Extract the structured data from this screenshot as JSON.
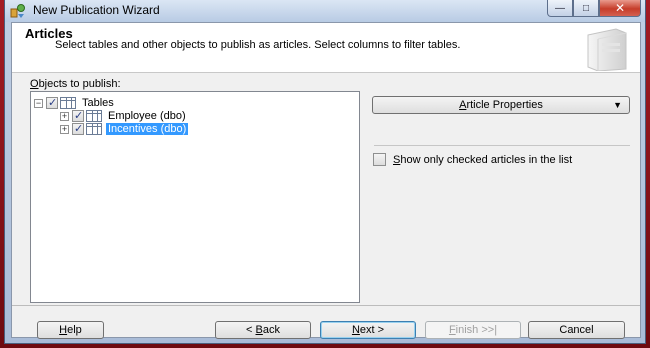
{
  "window": {
    "title": "New Publication Wizard",
    "minimize_glyph": "—",
    "maximize_glyph": "□",
    "close_glyph": "✕"
  },
  "header": {
    "title": "Articles",
    "description": "Select tables and other objects to publish as articles. Select columns to filter tables."
  },
  "objects": {
    "label_mnemonic": "O",
    "label_rest": "bjects to publish:",
    "tree": [
      {
        "label": "Tables",
        "expander": "−",
        "checked": true,
        "selected": false
      },
      {
        "label": "Employee (dbo)",
        "expander": "+",
        "checked": true,
        "selected": false
      },
      {
        "label": "Incentives (dbo)",
        "expander": "+",
        "checked": true,
        "selected": true
      }
    ]
  },
  "article_properties": {
    "mnemonic": "A",
    "rest": "rticle Properties",
    "arrow": "▼"
  },
  "show_only": {
    "mnemonic": "S",
    "rest": "how only checked articles in the list",
    "checked": false
  },
  "buttons": {
    "help": {
      "mnemonic": "H",
      "rest": "elp"
    },
    "back": {
      "prefix": "< ",
      "mnemonic": "B",
      "rest": "ack"
    },
    "next": {
      "mnemonic": "N",
      "rest": "ext >"
    },
    "finish": {
      "mnemonic": "F",
      "rest": "inish >>|"
    },
    "cancel": {
      "label": "Cancel"
    }
  },
  "colors": {
    "selection": "#3399ff",
    "check_mark": "#2a3e84",
    "close_button": "#c63d2a"
  }
}
